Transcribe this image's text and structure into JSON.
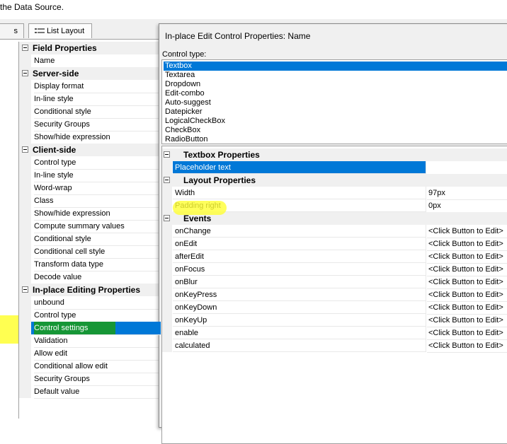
{
  "caption": "the Data Source.",
  "tabs": [
    "s",
    "List Layout"
  ],
  "left_grid": {
    "rows": [
      {
        "type": "cat",
        "label": "Field Properties"
      },
      {
        "type": "item",
        "label": "Name"
      },
      {
        "type": "cat",
        "label": "Server-side"
      },
      {
        "type": "item",
        "label": "Display format"
      },
      {
        "type": "item",
        "label": "In-line style"
      },
      {
        "type": "item",
        "label": "Conditional style"
      },
      {
        "type": "item",
        "label": "Security Groups"
      },
      {
        "type": "item",
        "label": "Show/hide expression"
      },
      {
        "type": "cat",
        "label": "Client-side"
      },
      {
        "type": "item",
        "label": "Control type"
      },
      {
        "type": "item",
        "label": "In-line style"
      },
      {
        "type": "item",
        "label": "Word-wrap"
      },
      {
        "type": "item",
        "label": "Class"
      },
      {
        "type": "item",
        "label": "Show/hide expression"
      },
      {
        "type": "item",
        "label": "Compute summary values"
      },
      {
        "type": "item",
        "label": "Conditional style"
      },
      {
        "type": "item",
        "label": "Conditional cell style"
      },
      {
        "type": "item",
        "label": "Transform data type"
      },
      {
        "type": "item",
        "label": "Decode value"
      },
      {
        "type": "cat",
        "label": "In-place Editing Properties"
      },
      {
        "type": "item",
        "label": "unbound"
      },
      {
        "type": "item",
        "label": "Control type"
      },
      {
        "type": "item",
        "label": "Control settings",
        "selected": true
      },
      {
        "type": "item",
        "label": "Validation"
      },
      {
        "type": "item",
        "label": "Allow edit"
      },
      {
        "type": "item",
        "label": "Conditional allow edit"
      },
      {
        "type": "item",
        "label": "Security Groups"
      },
      {
        "type": "item",
        "label": "Default value"
      }
    ]
  },
  "dialog": {
    "title": "In-place Edit Control Properties: Name",
    "control_type_label": "Control type:",
    "control_types": [
      "Textbox",
      "Textarea",
      "Dropdown",
      "Edit-combo",
      "Auto-suggest",
      "Datepicker",
      "LogicalCheckBox",
      "CheckBox",
      "RadioButton"
    ],
    "selected_control_type": "Textbox",
    "rows": [
      {
        "type": "cat",
        "label": "Textbox Properties"
      },
      {
        "type": "item",
        "label": "Placeholder text",
        "value": "",
        "selected": true
      },
      {
        "type": "cat",
        "label": "Layout Properties"
      },
      {
        "type": "item",
        "label": "Width",
        "value": "97px"
      },
      {
        "type": "item",
        "label": "Padding right",
        "value": "0px"
      },
      {
        "type": "cat",
        "label": "Events"
      },
      {
        "type": "item",
        "label": "onChange",
        "value": "<Click Button to Edit>"
      },
      {
        "type": "item",
        "label": "onEdit",
        "value": "<Click Button to Edit>"
      },
      {
        "type": "item",
        "label": "afterEdit",
        "value": "<Click Button to Edit>"
      },
      {
        "type": "item",
        "label": "onFocus",
        "value": "<Click Button to Edit>"
      },
      {
        "type": "item",
        "label": "onBlur",
        "value": "<Click Button to Edit>"
      },
      {
        "type": "item",
        "label": "onKeyPress",
        "value": "<Click Button to Edit>"
      },
      {
        "type": "item",
        "label": "onKeyDown",
        "value": "<Click Button to Edit>"
      },
      {
        "type": "item",
        "label": "onKeyUp",
        "value": "<Click Button to Edit>"
      },
      {
        "type": "item",
        "label": "enable",
        "value": "<Click Button to Edit>"
      },
      {
        "type": "item",
        "label": "calculated",
        "value": "<Click Button to Edit>"
      }
    ]
  },
  "colors": {
    "selection": "#0078d7",
    "highlight_yellow": "#ffff33",
    "highlight_green": "#1a9b1a"
  }
}
